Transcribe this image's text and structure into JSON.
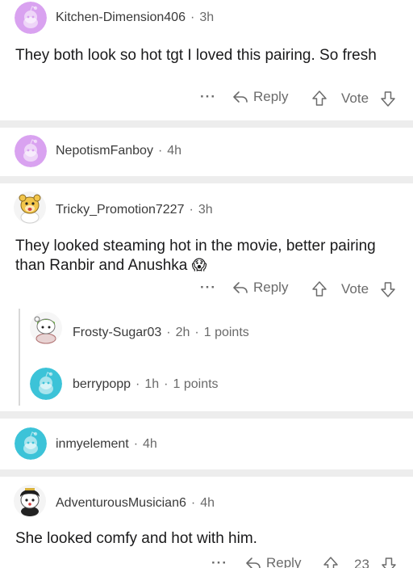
{
  "comments": [
    {
      "user": "Kitchen-Dimension406",
      "time": "3h",
      "text": "They both look so hot tgt I loved this pairing. So fresh",
      "avatar_color": "#d9a2f0",
      "icon": "snoo-avatar-icon"
    },
    {
      "user": "NepotismFanboy",
      "time": "4h",
      "avatar_color": "#d9a2f0",
      "icon": "snoo-avatar-icon"
    },
    {
      "user": "Tricky_Promotion7227",
      "time": "3h",
      "text": "They looked steaming hot in the movie, better pairing than Ranbir and Anushka",
      "emoji": "😱",
      "icon": "custom-snoo-avatar-icon"
    },
    {
      "user": "Frosty-Sugar03",
      "time": "2h",
      "points": "1 points",
      "icon": "custom-snoo-avatar-icon"
    },
    {
      "user": "berrypopp",
      "time": "1h",
      "points": "1 points",
      "avatar_color": "#3cc3d8",
      "icon": "snoo-avatar-icon"
    },
    {
      "user": "inmyelement",
      "time": "4h",
      "avatar_color": "#3cc3d8",
      "icon": "snoo-avatar-icon"
    },
    {
      "user": "AdventurousMusician6",
      "time": "4h",
      "text": "She looked comfy and hot with him.",
      "icon": "custom-snoo-avatar-icon"
    }
  ],
  "actions": {
    "more": "···",
    "reply": "Reply",
    "vote": "Vote",
    "count_last": "23"
  },
  "separator": "·",
  "colors": {
    "separator": "#ededed",
    "muted": "#6b6b6b",
    "thread_line": "#d8d8d8"
  }
}
